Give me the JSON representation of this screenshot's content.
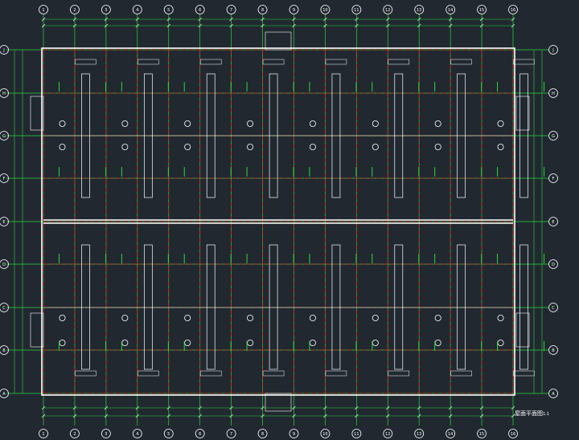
{
  "drawing": {
    "title": "屋面平面图",
    "scale_suffix": "1:1",
    "column_axes": [
      "1",
      "2",
      "3",
      "4",
      "5",
      "6",
      "7",
      "8",
      "9",
      "10",
      "11",
      "12",
      "13",
      "14",
      "15",
      "16"
    ],
    "row_axes": [
      "J",
      "H",
      "G",
      "F",
      "E",
      "D",
      "C",
      "B",
      "A"
    ],
    "colors": {
      "background": "#212830",
      "axis_line": "#2bd93b",
      "grid_red": "#e02424",
      "outline": "#ffffff",
      "bubble": "#ffffff"
    }
  }
}
